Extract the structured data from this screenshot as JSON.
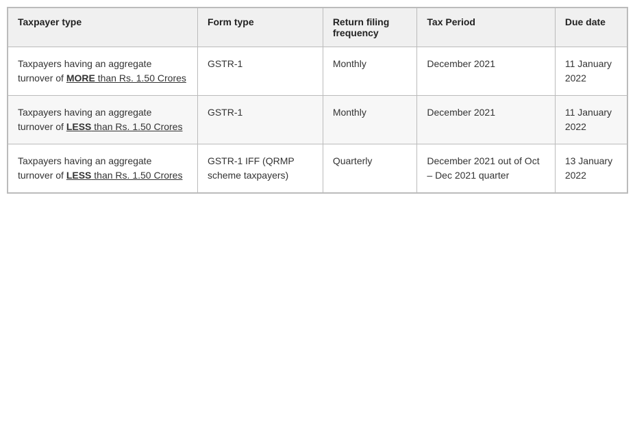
{
  "table": {
    "headers": [
      {
        "id": "taxpayer-type",
        "label": "Taxpayer type"
      },
      {
        "id": "form-type",
        "label": "Form type"
      },
      {
        "id": "filing-frequency",
        "label": "Return filing frequency"
      },
      {
        "id": "tax-period",
        "label": "Tax Period"
      },
      {
        "id": "due-date",
        "label": "Due date"
      }
    ],
    "rows": [
      {
        "taxpayer_type_prefix": "Taxpayers having an aggregate turnover of ",
        "taxpayer_type_highlight": "MORE",
        "taxpayer_type_suffix": " than Rs. 1.50 Crores",
        "form_type": "GSTR-1",
        "filing_frequency": "Monthly",
        "tax_period": "December 2021",
        "due_date": "11 January 2022"
      },
      {
        "taxpayer_type_prefix": "Taxpayers having an aggregate turnover of ",
        "taxpayer_type_highlight": "LESS",
        "taxpayer_type_suffix": " than Rs. 1.50 Crores",
        "form_type": "GSTR-1",
        "filing_frequency": "Monthly",
        "tax_period": "December 2021",
        "due_date": "11 January 2022"
      },
      {
        "taxpayer_type_prefix": "Taxpayers having an aggregate turnover of ",
        "taxpayer_type_highlight": "LESS",
        "taxpayer_type_suffix": " than Rs. 1.50 Crores",
        "form_type": "GSTR-1 IFF (QRMP scheme taxpayers)",
        "filing_frequency": "Quarterly",
        "tax_period": "December 2021 out of Oct – Dec 2021 quarter",
        "due_date": "13 January 2022"
      }
    ]
  }
}
